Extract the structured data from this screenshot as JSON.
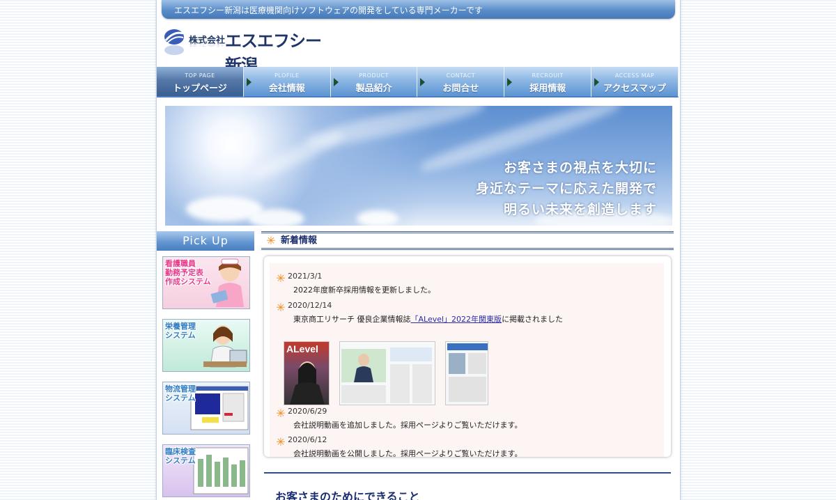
{
  "header": {
    "tagline": "エスエフシー新潟は医療機関向けソフトウェアの開発をしている専門メーカーです",
    "logo": {
      "prefix": "株式会社",
      "name": "エスエフシー新潟"
    }
  },
  "nav": [
    {
      "en": "TOP PAGE",
      "jp": "トップページ"
    },
    {
      "en": "PLOFILE",
      "jp": "会社情報"
    },
    {
      "en": "PRODUCT",
      "jp": "製品紹介"
    },
    {
      "en": "CONTACT",
      "jp": "お問合せ"
    },
    {
      "en": "RECROUIT",
      "jp": "採用情報"
    },
    {
      "en": "ACCESS MAP",
      "jp": "アクセスマップ"
    }
  ],
  "hero": {
    "lines": [
      "お客さまの視点を大切に",
      "身近なテーマに応えた開発で",
      "明るい未来を創造します"
    ]
  },
  "sidebar": {
    "title": "Pick Up",
    "items": [
      {
        "label": "看護職員\n勤務予定表\n作成システム",
        "color": "#e83a8a"
      },
      {
        "label": "栄養管理\nシステム",
        "color": "#2e7cc4"
      },
      {
        "label": "物流管理\nシステム",
        "color": "#2e7cc4"
      },
      {
        "label": "臨床検査\nシステム",
        "color": "#2e7cc4"
      }
    ]
  },
  "news": {
    "title": "新着情報",
    "items": [
      {
        "date": "2021/3/1",
        "text": "2022年度新卒採用情報を更新しました。"
      },
      {
        "date": "2020/12/14",
        "text_before": "東京商工リサーチ 優良企業情報誌",
        "link": "「ALevel」2022年関東版",
        "text_after": "に掲載されました"
      },
      {
        "date": "2020/6/29",
        "text": "会社説明動画を追加しました。採用ページよりご覧いただけます。"
      },
      {
        "date": "2020/6/12",
        "text": "会社説明動画を公開しました。採用ページよりご覧いただけます。"
      }
    ],
    "magazine_cover_title": "ALevel"
  },
  "section2": {
    "title": "お客さまのためにできること"
  },
  "colors": {
    "accent": "#4a7fc0",
    "nav_active": "#3a5f92",
    "heading": "#1b2f6a",
    "bullet": "#f08a1c"
  }
}
